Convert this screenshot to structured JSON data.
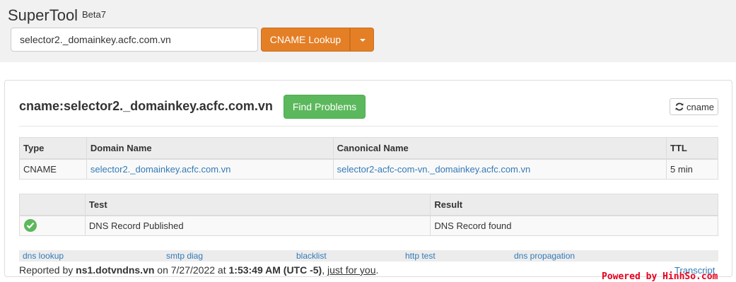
{
  "header": {
    "brand": "SuperTool",
    "version": "Beta7",
    "search_value": "selector2._domainkey.acfc.com.vn",
    "lookup_label": "CNAME Lookup"
  },
  "result": {
    "title": "cname:selector2._domainkey.acfc.com.vn",
    "find_problems_label": "Find Problems",
    "refresh_label": "cname"
  },
  "records_table": {
    "headers": [
      "Type",
      "Domain Name",
      "Canonical Name",
      "TTL"
    ],
    "rows": [
      {
        "type": "CNAME",
        "domain": "selector2._domainkey.acfc.com.vn",
        "canonical": "selector2-acfc-com-vn._domainkey.acfc.com.vn",
        "ttl": "5 min"
      }
    ]
  },
  "tests_table": {
    "headers": [
      "",
      "Test",
      "Result"
    ],
    "rows": [
      {
        "status_icon": "check-circle-icon",
        "test": "DNS Record Published",
        "result": "DNS Record found"
      }
    ]
  },
  "links": [
    "dns lookup",
    "smtp diag",
    "blacklist",
    "http test",
    "dns propagation"
  ],
  "footer": {
    "prefix": "Reported by",
    "server": "ns1.dotvndns.vn",
    "on_text": "on 7/27/2022 at",
    "time": "1:53:49 AM (UTC -5)",
    "sep": ",",
    "just_for_you": "just for you",
    "end": ".",
    "transcript": "Transcript"
  },
  "watermark": "Powered by HinhSo.com",
  "colors": {
    "lookup_button": "#e47f26",
    "find_button": "#5cb85c",
    "link": "#337ab7",
    "watermark": "#e8001c"
  }
}
